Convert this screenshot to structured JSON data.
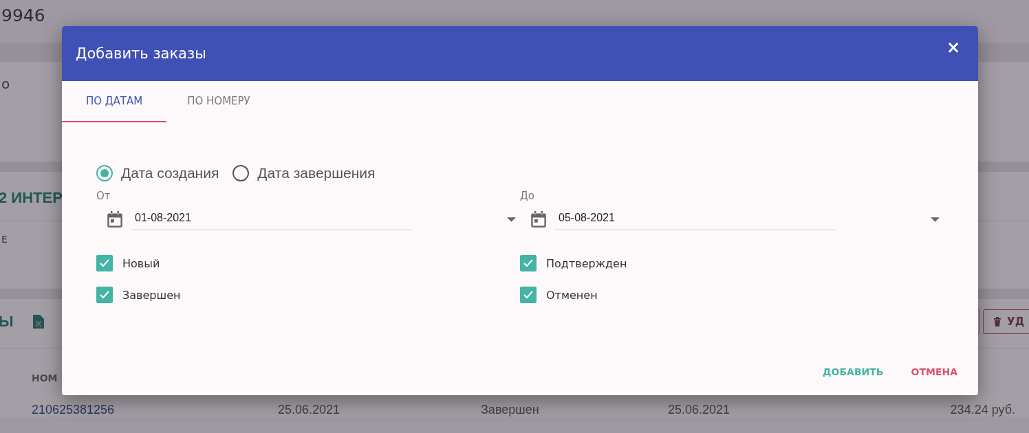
{
  "page": {
    "title": "9946",
    "card_1_text": "о",
    "section_title": "2 ИНТЕР",
    "section_text": "Е",
    "orders_title": "Ы",
    "table_heading": "НОМ",
    "row": [
      "210625381256",
      "25.06.2021",
      "Завершен",
      "25.06.2021",
      "234.24 руб."
    ],
    "delete_button": "УД"
  },
  "dialog": {
    "title": "Добавить заказы",
    "close": "×",
    "tabs": [
      {
        "label": "ПО ДАТАМ",
        "selected": true
      },
      {
        "label": "ПО НОМЕРУ",
        "selected": false
      }
    ],
    "date_type": [
      {
        "label": "Дата создания",
        "selected": true
      },
      {
        "label": "Дата завершения",
        "selected": false
      }
    ],
    "ranges": [
      {
        "label": "От",
        "value": "01-08-2021"
      },
      {
        "label": "До",
        "value": "05-08-2021"
      }
    ],
    "statuses": [
      [
        {
          "label": "Новый",
          "checked": true
        },
        {
          "label": "Завершен",
          "checked": true
        }
      ],
      [
        {
          "label": "Подтвержден",
          "checked": true
        },
        {
          "label": "Отменен",
          "checked": true
        }
      ]
    ],
    "buttons": [
      {
        "label": "ДОБАВИТЬ",
        "kind": "confirm"
      },
      {
        "label": "ОТМЕНА",
        "kind": "cancel"
      }
    ]
  }
}
